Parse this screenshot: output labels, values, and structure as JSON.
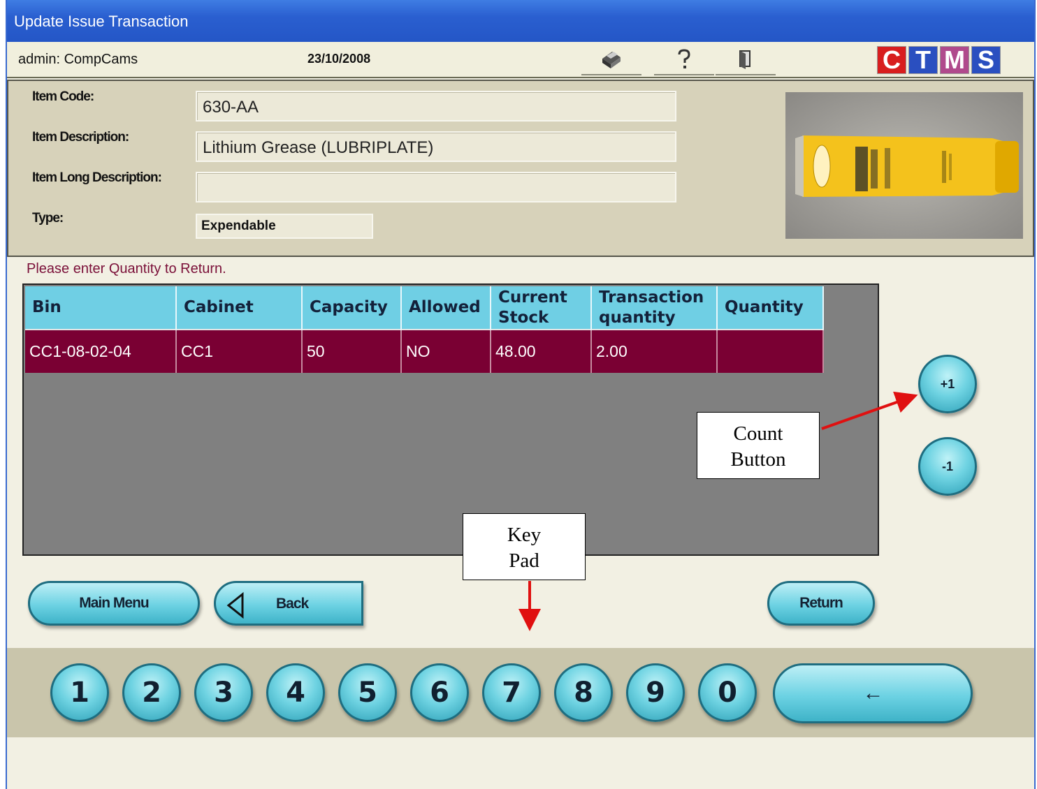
{
  "window": {
    "title": "Update Issue Transaction"
  },
  "infobar": {
    "user": "admin: CompCams",
    "date": "23/10/2008"
  },
  "logo": {
    "letters": [
      "C",
      "T",
      "M",
      "S"
    ],
    "colors": [
      "#d81e1e",
      "#2a4fc0",
      "#b04a8c",
      "#2a4fc0"
    ]
  },
  "item": {
    "code_label": "Item Code:",
    "code_value": "630-AA",
    "desc_label": "Item Description:",
    "desc_value": "Lithium Grease (LUBRIPLATE)",
    "long_desc_label": "Item Long Description:",
    "long_desc_value": "",
    "type_label": "Type:",
    "type_value": "Expendable"
  },
  "instruction": "Please enter Quantity to Return.",
  "table": {
    "headers": [
      "Bin",
      "Cabinet",
      "Capacity",
      "Allowed",
      "Current Stock",
      "Transaction quantity",
      "Quantity"
    ],
    "rows": [
      [
        "CC1-08-02-04",
        "CC1",
        "50",
        "NO",
        "48.00",
        "2.00",
        ""
      ]
    ]
  },
  "count": {
    "plus_label": "+1",
    "minus_label": "-1"
  },
  "buttons": {
    "main_menu": "Main Menu",
    "back": "Back",
    "return": "Return"
  },
  "keypad": {
    "keys": [
      "1",
      "2",
      "3",
      "4",
      "5",
      "6",
      "7",
      "8",
      "9",
      "0"
    ],
    "backspace": "←"
  },
  "annotations": {
    "count_button": "Count Button",
    "key_pad": "Key Pad"
  },
  "toolbar_icons": [
    "printer-icon",
    "help-icon",
    "exit-door-icon"
  ]
}
